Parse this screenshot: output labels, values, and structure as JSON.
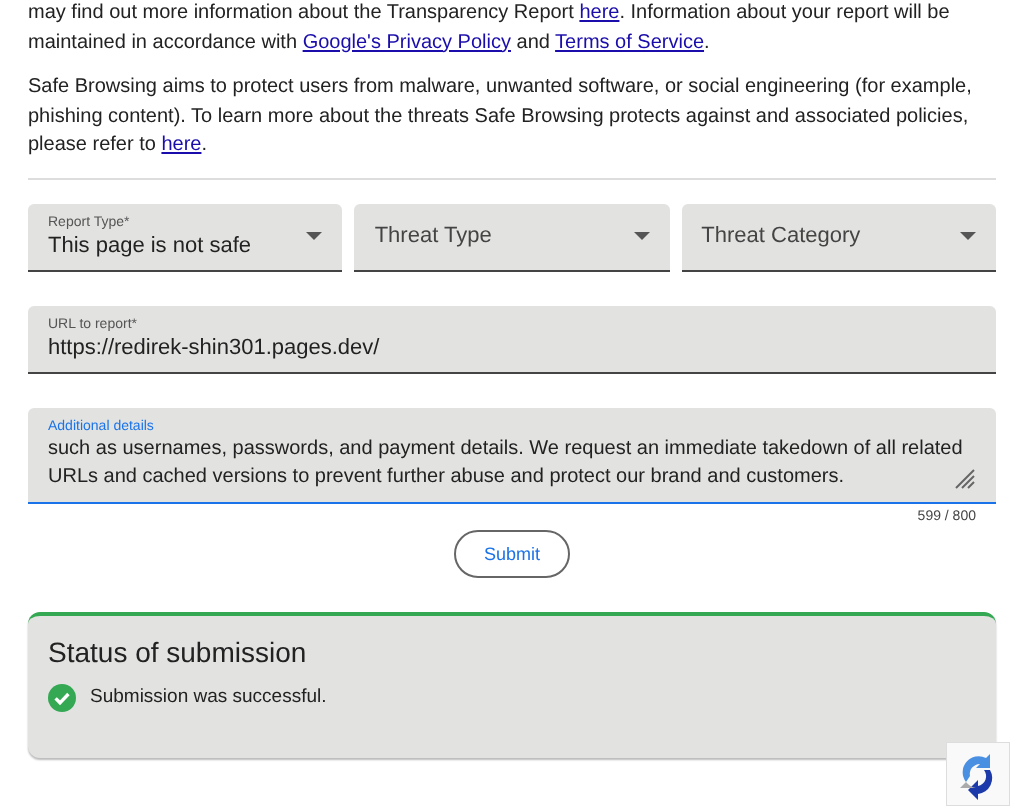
{
  "intro_paragraphs": [
    [
      {
        "text": "may find out more information about the Transparency Report ",
        "link": false
      },
      {
        "text": "here",
        "link": true
      },
      {
        "text": ". Information about your report will be maintained in accordance with ",
        "link": false
      },
      {
        "text": "Google's Privacy Policy",
        "link": true
      },
      {
        "text": " and ",
        "link": false
      },
      {
        "text": "Terms of Service",
        "link": true
      },
      {
        "text": ".",
        "link": false
      }
    ],
    [
      {
        "text": "Safe Browsing aims to protect users from malware, unwanted software, or social engineering (for example, phishing content). To learn more about the threats Safe Browsing protects against and associated policies, please refer to ",
        "link": false
      },
      {
        "text": "here",
        "link": true
      },
      {
        "text": ".",
        "link": false
      }
    ]
  ],
  "dropdowns": [
    {
      "label": "Report Type*",
      "value": "This page is not safe"
    },
    {
      "placeholder": "Threat Type"
    },
    {
      "placeholder": "Threat Category"
    }
  ],
  "url_field": {
    "label": "URL to report*",
    "value": "https://redirek-shin301.pages.dev/"
  },
  "details_field": {
    "label": "Additional details",
    "focused": true,
    "lines": [
      "such as usernames, passwords, and payment details. We request an immediate takedown of all related",
      "URLs and cached versions to prevent further abuse and protect our brand and customers."
    ],
    "counter": "599 / 800"
  },
  "submit_button": "Submit",
  "status": {
    "title": "Status of submission",
    "kind": "success",
    "message": "Submission was successful."
  }
}
